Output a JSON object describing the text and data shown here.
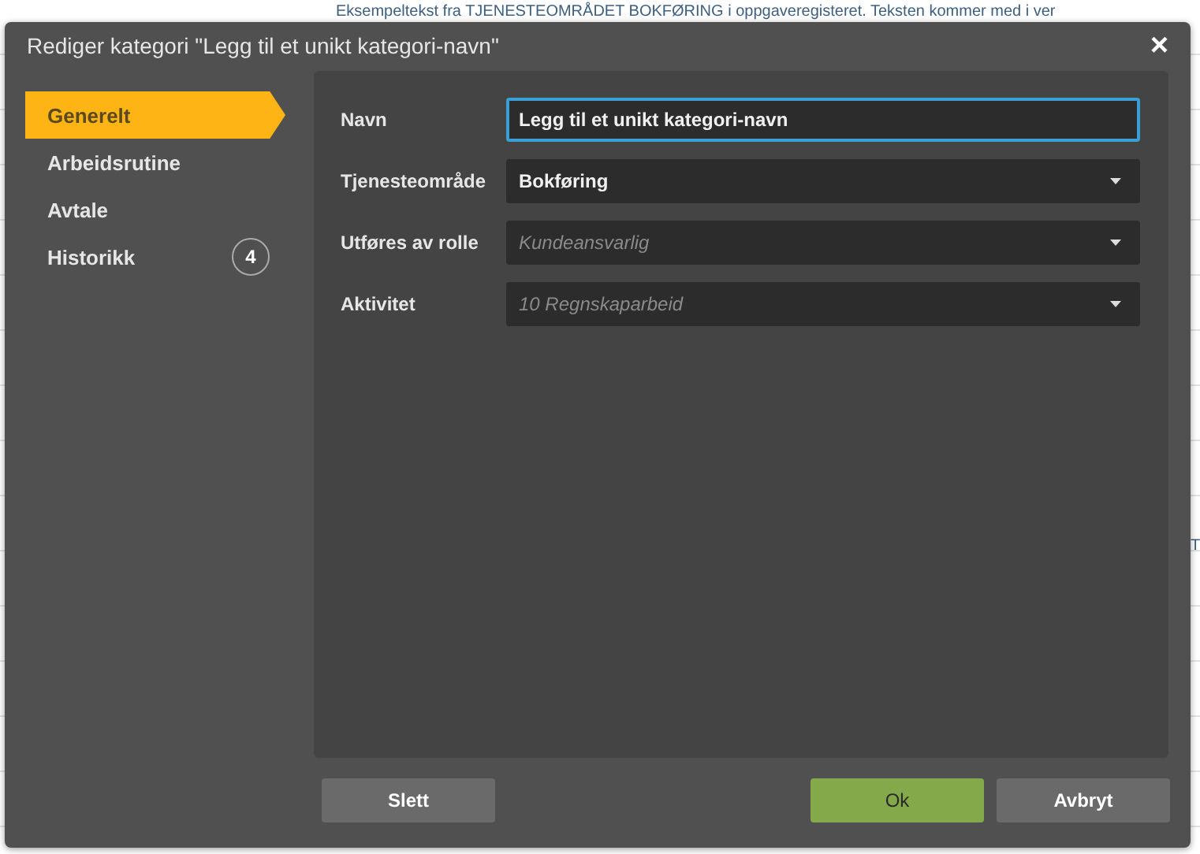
{
  "background": {
    "text": "Eksempeltekst fra TJENESTEOMRÅDET BOKFØRING i oppgaveregisteret. Teksten kommer med i ver",
    "edge_text": "T"
  },
  "dialog": {
    "title": "Rediger kategori \"Legg til et unikt kategori-navn\"",
    "close": "×"
  },
  "sidebar": {
    "items": [
      {
        "label": "Generelt",
        "selected": true
      },
      {
        "label": "Arbeidsrutine",
        "selected": false
      },
      {
        "label": "Avtale",
        "selected": false
      },
      {
        "label": "Historikk",
        "selected": false,
        "count": "4"
      }
    ]
  },
  "form": {
    "fields": [
      {
        "label": "Navn",
        "kind": "text",
        "value": "Legg til et unikt kategori-navn",
        "focused": true
      },
      {
        "label": "Tjenesteområde",
        "kind": "select",
        "value": "Bokføring"
      },
      {
        "label": "Utføres av rolle",
        "kind": "select",
        "placeholder": "Kundeansvarlig"
      },
      {
        "label": "Aktivitet",
        "kind": "select",
        "placeholder": "10 Regnskaparbeid"
      }
    ]
  },
  "buttons": [
    {
      "label": "Slett",
      "kind": "neutral"
    },
    {
      "label": "Ok",
      "kind": "primary"
    },
    {
      "label": "Avbryt",
      "kind": "neutral"
    }
  ]
}
